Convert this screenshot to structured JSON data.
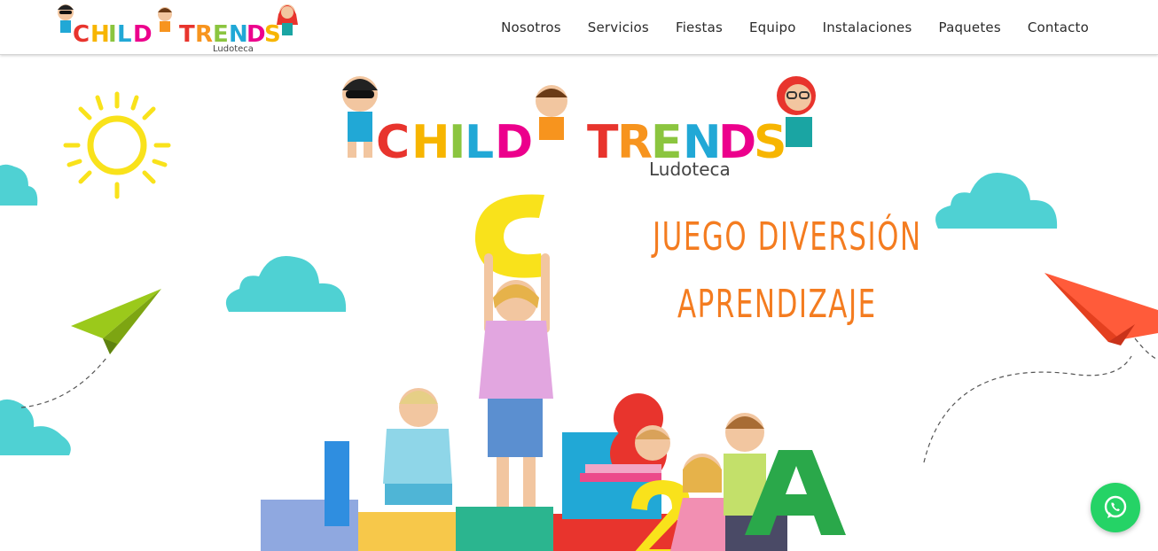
{
  "brand": {
    "name": "CHILDTRENDS",
    "subtitle": "Ludoteca"
  },
  "nav": {
    "items": [
      "Nosotros",
      "Servicios",
      "Fiestas",
      "Equipo",
      "Instalaciones",
      "Paquetes",
      "Contacto"
    ]
  },
  "hero": {
    "slogan_line1": "JUEGO  DIVERSIÓN",
    "slogan_line2": "APRENDIZAJE"
  },
  "colors": {
    "slogan": "#f47c20",
    "cloud": "#4fd1d3",
    "sun": "#f9e21b",
    "whatsapp": "#25d366",
    "plane_green": "#9bc91b",
    "plane_red": "#ff5b3a"
  },
  "icons": [
    "sun-icon",
    "cloud-icon",
    "paper-plane-icon",
    "whatsapp-icon"
  ]
}
